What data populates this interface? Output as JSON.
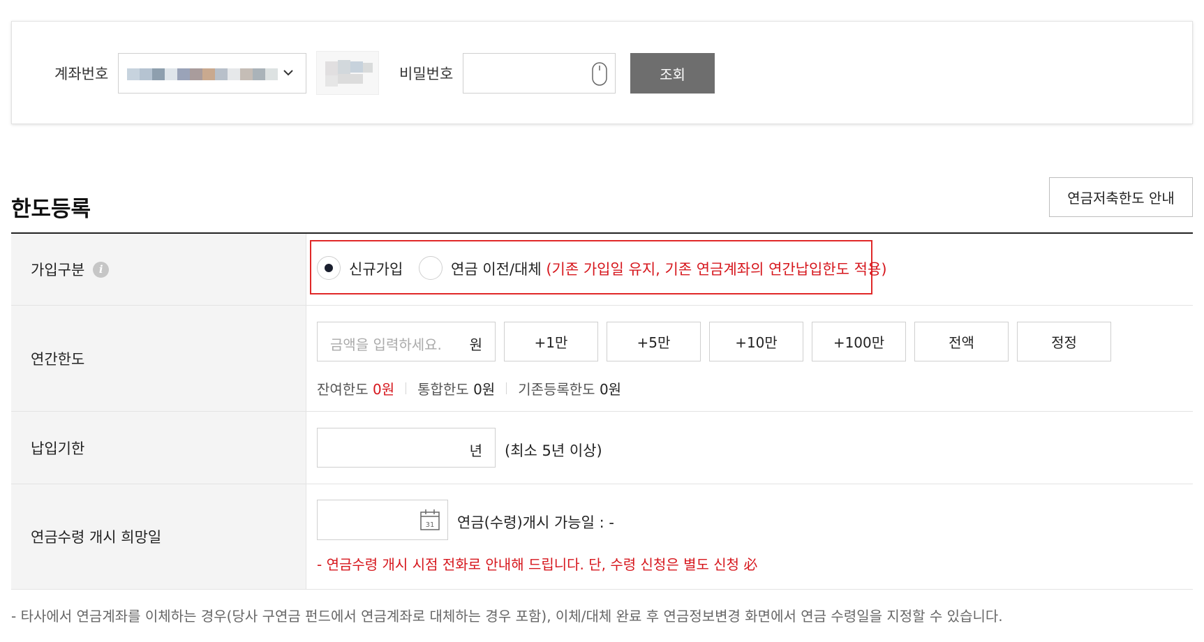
{
  "query": {
    "account_label": "계좌번호",
    "password_label": "비밀번호",
    "search_button": "조회"
  },
  "section": {
    "title": "한도등록",
    "guide_button": "연금저축한도 안내"
  },
  "form": {
    "join_type": {
      "label": "가입구분",
      "options": [
        {
          "label": "신규가입",
          "selected": true
        },
        {
          "label": "연금 이전/대체",
          "note": "(기존 가입일 유지, 기존 연금계좌의 연간납입한도 적용)",
          "selected": false
        }
      ]
    },
    "annual_limit": {
      "label": "연간한도",
      "placeholder": "금액을 입력하세요.",
      "unit": "원",
      "buttons": [
        "+1만",
        "+5만",
        "+10만",
        "+100만",
        "전액",
        "정정"
      ],
      "remaining_label": "잔여한도",
      "remaining_value": "0원",
      "combined_label": "통합한도",
      "combined_value": "0원",
      "registered_label": "기존등록한도",
      "registered_value": "0원"
    },
    "payment_period": {
      "label": "납입기한",
      "unit": "년",
      "note": "(최소 5년 이상)"
    },
    "pension_start": {
      "label": "연금수령 개시 희망일",
      "available_text": "연금(수령)개시 가능일 : -",
      "warning": "- 연금수령 개시 시점 전화로 안내해 드립니다. 단, 수령 신청은 별도 신청 必"
    }
  },
  "footnote": "- 타사에서 연금계좌를 이체하는 경우(당사 구연금 펀드에서 연금계좌로 대체하는 경우 포함), 이체/대체 완료 후 연금정보변경 화면에서 연금 수령일을 지정할 수 있습니다.",
  "colors": {
    "accent_red": "#d6161c",
    "highlight_border": "#e02828",
    "search_button_bg": "#6e6e6e",
    "header_cell_bg": "#f4f4f4"
  }
}
